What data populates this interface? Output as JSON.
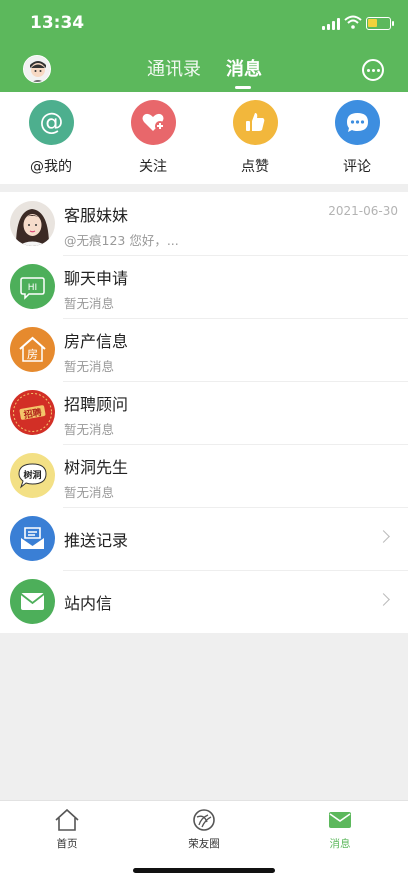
{
  "status_bar": {
    "time": "13:34"
  },
  "header": {
    "tabs": [
      {
        "label": "通讯录"
      },
      {
        "label": "消息"
      }
    ],
    "active_tab": "消息"
  },
  "quick_actions": [
    {
      "label": "@我的",
      "icon": "at-icon",
      "color": "#4daf8e"
    },
    {
      "label": "关注",
      "icon": "heart-plus-icon",
      "color": "#e8676b"
    },
    {
      "label": "点赞",
      "icon": "thumbs-up-icon",
      "color": "#f2b73c"
    },
    {
      "label": "评论",
      "icon": "comment-icon",
      "color": "#3d8ee0"
    }
  ],
  "messages": [
    {
      "title": "客服妹妹",
      "subtitle": "@无痕123 您好，...",
      "date": "2021-06-30",
      "icon": "avatar-photo"
    },
    {
      "title": "聊天申请",
      "subtitle": "暂无消息",
      "icon": "hi-chat-icon",
      "icon_text": "HI"
    },
    {
      "title": "房产信息",
      "subtitle": "暂无消息",
      "icon": "house-icon",
      "icon_text": "房"
    },
    {
      "title": "招聘顾问",
      "subtitle": "暂无消息",
      "icon": "recruit-badge-icon",
      "icon_text": "招聘"
    },
    {
      "title": "树洞先生",
      "subtitle": "暂无消息",
      "icon": "tree-hole-icon",
      "icon_text": "树洞"
    },
    {
      "title": "推送记录",
      "icon": "push-inbox-icon"
    },
    {
      "title": "站内信",
      "icon": "mail-icon"
    }
  ],
  "bottom_nav": [
    {
      "label": "首页",
      "icon": "home-icon"
    },
    {
      "label": "荣友圈",
      "icon": "circle-icon"
    },
    {
      "label": "消息",
      "icon": "message-envelope-icon",
      "active": true
    }
  ],
  "colors": {
    "brand_green": "#5cb85c"
  }
}
